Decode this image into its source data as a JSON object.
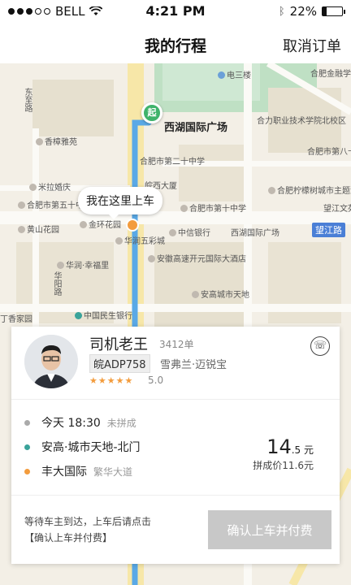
{
  "status": {
    "carrier": "BELL",
    "time": "4:21 PM",
    "battery": "22%",
    "battery_level": 0.22
  },
  "nav": {
    "title": "我的行程",
    "action": "取消订单"
  },
  "map": {
    "start_marker": "起",
    "bubble": "我在这里上车",
    "road_sign": "望江路",
    "labels": [
      "东至路",
      "香樟雅苑",
      "合肥市第二十中学",
      "皖西大厦",
      "合肥市第十中学",
      "合肥市",
      "西湖国际广场",
      "合力职业技术学院北校区",
      "合肥市第八十中学",
      "合肥柠檬树城市主题酒店",
      "米拉婚庆",
      "合肥市第五十中学",
      "黄山花园",
      "金环花园",
      "中信银行",
      "西湖国际广场",
      "华润五彩城",
      "安徽高速开元国际大酒店",
      "华润·幸福里",
      "安高城市天地",
      "中国民生银行",
      "丁香家园",
      "电三楼",
      "合肥金融学",
      "望江文苑",
      "华阳路"
    ]
  },
  "driver": {
    "name": "司机老王",
    "orders": "3412单",
    "plate": "皖ADP758",
    "car": "雪弗兰·迈锐宝",
    "stars": "★★★★★",
    "rating": "5.0"
  },
  "trip": {
    "time": "今天 18:30",
    "carpool": "未拼成",
    "from": "安高·城市天地-北门",
    "to": "丰大国际",
    "to_area": "繁华大道",
    "price_int": "14",
    "price_dec": ".5 元",
    "carpool_price": "拼成价11.6元"
  },
  "footer": {
    "line1": "等待车主到达，上车后请点击",
    "line2": "【确认上车并付费】",
    "button": "确认上车并付费"
  }
}
